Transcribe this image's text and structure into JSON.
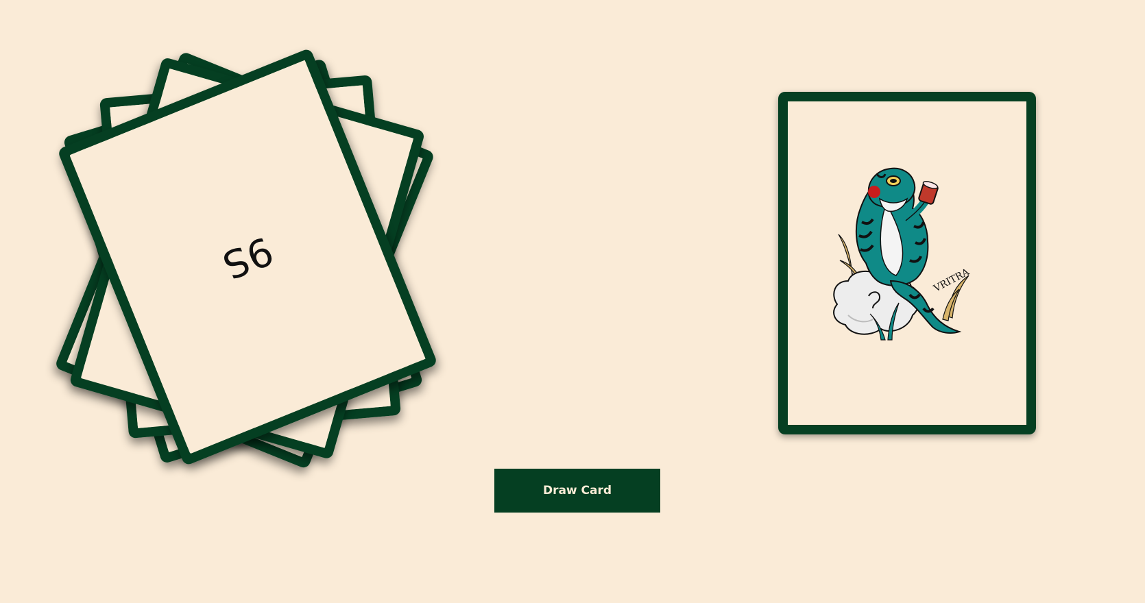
{
  "colors": {
    "background": "#faebd7",
    "card_border": "#053f22",
    "card_face": "#faebd7",
    "button_bg": "#053f22",
    "button_text": "#fbecd6",
    "frog_green": "#0f8a87",
    "frog_stripes": "#0b0b0b",
    "rock": "#ededed",
    "cup_red": "#c0392b",
    "cheek_red": "#c81d1d",
    "grass_gold": "#d8b46a"
  },
  "deck": {
    "top_card_text": "9S",
    "stacked_card_count": 5
  },
  "drawn_card": {
    "image_icon": "frog-tattoo-illustration",
    "signature": "VRITRA"
  },
  "controls": {
    "draw_button_label": "Draw Card"
  }
}
